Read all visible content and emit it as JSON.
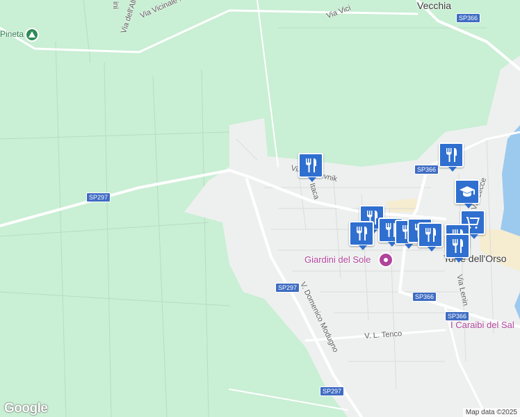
{
  "map": {
    "labels": {
      "via_vicinale_mancarella": "Via Vicinale Mancarella",
      "via_dell_alloro": "Via dell'Allor",
      "via_vic_top": "Via Vici",
      "via_lecce": "Via Lecce",
      "via_lenin": "Via Lenin",
      "v_domenico_modugno": "V. Domenico Modugno",
      "v_l_tenco": "V. L. Tenco",
      "via_itaca": "Itaca",
      "via_dubrovnik": "Via Dubrovnik",
      "ini": "ini",
      "pineta": "Pineta"
    },
    "places": {
      "vecchia": "Vecchia",
      "torre_dell_orso": "Torre dell'Orso",
      "giardini_del_sole": "Giardini del Sole",
      "i_caraibi_del_salento": "I Caraibi del Sal"
    },
    "road_shields": {
      "sp297_west": "SP297",
      "sp297_mid": "SP297",
      "sp297_south": "SP297",
      "sp366_top": "SP366",
      "sp366_mid": "SP366",
      "sp366_east": "SP366",
      "sp366_south": "SP366"
    },
    "markers": {
      "restaurant_icon": "fork-knife",
      "school_icon": "graduation-cap",
      "shopping_icon": "shopping-cart",
      "poi_icon": "flower"
    },
    "colors": {
      "land_green": "#c9efd4",
      "urban": "#eef0ef",
      "road": "#ffffff",
      "marker_blue": "#2f6fcf",
      "water": "#9cc9ee",
      "sand": "#f6ecd0",
      "poi_pink": "#b0449b",
      "shield_blue": "#3f6cc2"
    }
  },
  "footer": {
    "google_logo": "Google",
    "attribution": "Map data ©2025"
  }
}
